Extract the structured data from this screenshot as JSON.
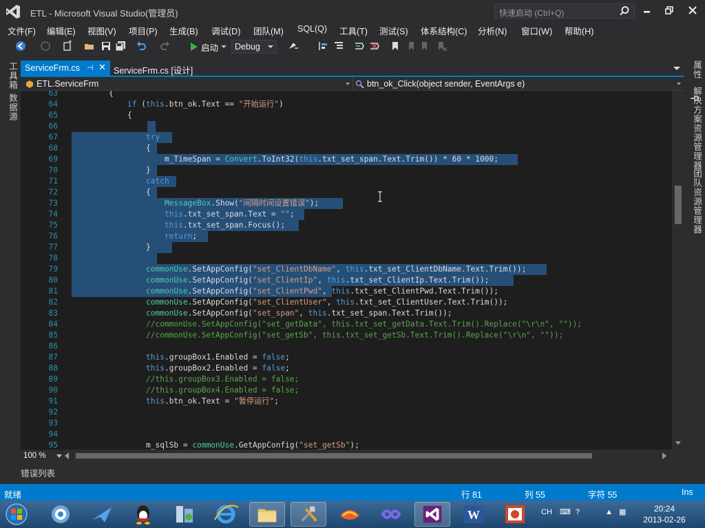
{
  "window": {
    "title": "ETL - Microsoft Visual Studio(管理员)",
    "quick_launch_placeholder": "快速启动 (Ctrl+Q)"
  },
  "menu": [
    "文件(F)",
    "编辑(E)",
    "视图(V)",
    "项目(P)",
    "生成(B)",
    "调试(D)",
    "团队(M)",
    "SQL(Q)",
    "工具(T)",
    "测试(S)",
    "体系结构(C)",
    "分析(N)",
    "窗口(W)",
    "帮助(H)"
  ],
  "toolbar": {
    "start_label": "启动",
    "config_value": "Debug"
  },
  "left_panels": [
    "工具箱",
    "数据源"
  ],
  "right_panels": [
    "属性",
    "解决方案资源管理器",
    "团队资源管理器"
  ],
  "tabs": [
    {
      "label": "ServiceFrm.cs",
      "active": true
    },
    {
      "label": "ServiceFrm.cs [设计]",
      "active": false
    }
  ],
  "navbar": {
    "class_name": "ETL.ServiceFrm",
    "member_name": "btn_ok_Click(object sender, EventArgs e)"
  },
  "editor": {
    "zoom": "100 %",
    "lines": [
      {
        "n": "63",
        "indent": 4,
        "tokens": [
          [
            "p",
            "{"
          ]
        ]
      },
      {
        "n": "64",
        "indent": 6,
        "tokens": [
          [
            "k",
            "if"
          ],
          [
            "p",
            " ("
          ],
          [
            "k",
            "this"
          ],
          [
            "p",
            ".btn_ok.Text == "
          ],
          [
            "s",
            "\"开始运行\""
          ],
          [
            "p",
            ")"
          ]
        ]
      },
      {
        "n": "65",
        "indent": 6,
        "tokens": [
          [
            "p",
            "{"
          ]
        ]
      },
      {
        "n": "66",
        "indent": 0,
        "tokens": []
      },
      {
        "n": "67",
        "indent": 8,
        "tokens": [
          [
            "k",
            "try"
          ]
        ]
      },
      {
        "n": "68",
        "indent": 8,
        "tokens": [
          [
            "p",
            "{"
          ]
        ]
      },
      {
        "n": "69",
        "indent": 10,
        "tokens": [
          [
            "p",
            "m_TimeSpan = "
          ],
          [
            "t",
            "Convert"
          ],
          [
            "p",
            ".ToInt32("
          ],
          [
            "k",
            "this"
          ],
          [
            "p",
            ".txt_set_span.Text.Trim()) * 60 * 1000;"
          ]
        ]
      },
      {
        "n": "70",
        "indent": 8,
        "tokens": [
          [
            "p",
            "}"
          ]
        ]
      },
      {
        "n": "71",
        "indent": 8,
        "tokens": [
          [
            "k",
            "catch"
          ]
        ]
      },
      {
        "n": "72",
        "indent": 8,
        "tokens": [
          [
            "p",
            "{"
          ]
        ]
      },
      {
        "n": "73",
        "indent": 10,
        "tokens": [
          [
            "t",
            "MessageBox"
          ],
          [
            "p",
            ".Show("
          ],
          [
            "s",
            "\"间隔时间设置错误\""
          ],
          [
            "p",
            ");"
          ]
        ]
      },
      {
        "n": "74",
        "indent": 10,
        "tokens": [
          [
            "k",
            "this"
          ],
          [
            "p",
            ".txt_set_span.Text = "
          ],
          [
            "s",
            "\"\""
          ],
          [
            "p",
            ";"
          ]
        ]
      },
      {
        "n": "75",
        "indent": 10,
        "tokens": [
          [
            "k",
            "this"
          ],
          [
            "p",
            ".txt_set_span.Focus();"
          ]
        ]
      },
      {
        "n": "76",
        "indent": 10,
        "tokens": [
          [
            "k",
            "return"
          ],
          [
            "p",
            ";"
          ]
        ]
      },
      {
        "n": "77",
        "indent": 8,
        "tokens": [
          [
            "p",
            "}"
          ]
        ]
      },
      {
        "n": "78",
        "indent": 0,
        "tokens": []
      },
      {
        "n": "79",
        "indent": 8,
        "tokens": [
          [
            "t",
            "commonUse"
          ],
          [
            "p",
            ".SetAppConfig("
          ],
          [
            "s",
            "\"set_ClientDbName\""
          ],
          [
            "p",
            ", "
          ],
          [
            "k",
            "this"
          ],
          [
            "p",
            ".txt_set_ClientDbName.Text.Trim());"
          ]
        ]
      },
      {
        "n": "80",
        "indent": 8,
        "tokens": [
          [
            "t",
            "commonUse"
          ],
          [
            "p",
            ".SetAppConfig("
          ],
          [
            "s",
            "\"set_ClientIp\""
          ],
          [
            "p",
            ", "
          ],
          [
            "k",
            "this"
          ],
          [
            "p",
            ".txt_set_ClientIp.Text.Trim());"
          ]
        ]
      },
      {
        "n": "81",
        "indent": 8,
        "tokens": [
          [
            "t",
            "commonUse"
          ],
          [
            "p",
            ".SetAppConfig("
          ],
          [
            "s",
            "\"set_ClientPwd\""
          ],
          [
            "p",
            ", "
          ],
          [
            "k",
            "this"
          ],
          [
            "p",
            ".txt_set_ClientPwd.Text.Trim());"
          ]
        ]
      },
      {
        "n": "82",
        "indent": 8,
        "tokens": [
          [
            "t",
            "commonUse"
          ],
          [
            "p",
            ".SetAppConfig("
          ],
          [
            "s",
            "\"set_ClientUser\""
          ],
          [
            "p",
            ", "
          ],
          [
            "k",
            "this"
          ],
          [
            "p",
            ".txt_set_ClientUser.Text.Trim());"
          ]
        ]
      },
      {
        "n": "83",
        "indent": 8,
        "tokens": [
          [
            "t",
            "commonUse"
          ],
          [
            "p",
            ".SetAppConfig("
          ],
          [
            "s",
            "\"set_span\""
          ],
          [
            "p",
            ", "
          ],
          [
            "k",
            "this"
          ],
          [
            "p",
            ".txt_set_span.Text.Trim());"
          ]
        ]
      },
      {
        "n": "84",
        "indent": 8,
        "tokens": [
          [
            "c",
            "//commonUse.SetAppConfig(\"set_getData\", this.txt_set_getData.Text.Trim().Replace(\"\\r\\n\", \"\"));"
          ]
        ]
      },
      {
        "n": "85",
        "indent": 8,
        "tokens": [
          [
            "c",
            "//commonUse.SetAppConfig(\"set_getSb\", this.txt_set_getSb.Text.Trim().Replace(\"\\r\\n\", \"\"));"
          ]
        ]
      },
      {
        "n": "86",
        "indent": 0,
        "tokens": []
      },
      {
        "n": "87",
        "indent": 8,
        "tokens": [
          [
            "k",
            "this"
          ],
          [
            "p",
            ".groupBox1.Enabled = "
          ],
          [
            "k",
            "false"
          ],
          [
            "p",
            ";"
          ]
        ]
      },
      {
        "n": "88",
        "indent": 8,
        "tokens": [
          [
            "k",
            "this"
          ],
          [
            "p",
            ".groupBox2.Enabled = "
          ],
          [
            "k",
            "false"
          ],
          [
            "p",
            ";"
          ]
        ]
      },
      {
        "n": "89",
        "indent": 8,
        "tokens": [
          [
            "c",
            "//this.groupBox3.Enabled = false;"
          ]
        ]
      },
      {
        "n": "90",
        "indent": 8,
        "tokens": [
          [
            "c",
            "//this.groupBox4.Enabled = false;"
          ]
        ]
      },
      {
        "n": "91",
        "indent": 8,
        "tokens": [
          [
            "k",
            "this"
          ],
          [
            "p",
            ".btn_ok.Text = "
          ],
          [
            "s",
            "\"暂停运行\""
          ],
          [
            "p",
            ";"
          ]
        ]
      },
      {
        "n": "92",
        "indent": 0,
        "tokens": []
      },
      {
        "n": "93",
        "indent": 0,
        "tokens": []
      },
      {
        "n": "94",
        "indent": 0,
        "tokens": []
      },
      {
        "n": "95",
        "indent": 8,
        "tokens": [
          [
            "p",
            "m_sqlSb = "
          ],
          [
            "t",
            "commonUse"
          ],
          [
            "p",
            ".GetAppConfig("
          ],
          [
            "s",
            "\"set_getSb\""
          ],
          [
            "p",
            ");"
          ]
        ]
      }
    ]
  },
  "bottom_panel": {
    "error_list": "错误列表"
  },
  "status": {
    "ready": "就绪",
    "line": "行 81",
    "col": "列 55",
    "char": "字符 55",
    "mode": "Ins"
  },
  "taskbar": {
    "input_lang": "CH",
    "time": "20:24",
    "date": "2013-02-26"
  },
  "colors": {
    "accent": "#007acc",
    "editor_bg": "#1e1e1e",
    "selection": "#264f78",
    "keyword": "#569cd6",
    "string": "#d69d85",
    "type": "#4ec9b0",
    "comment": "#57a64a",
    "line_number": "#2b91af"
  }
}
